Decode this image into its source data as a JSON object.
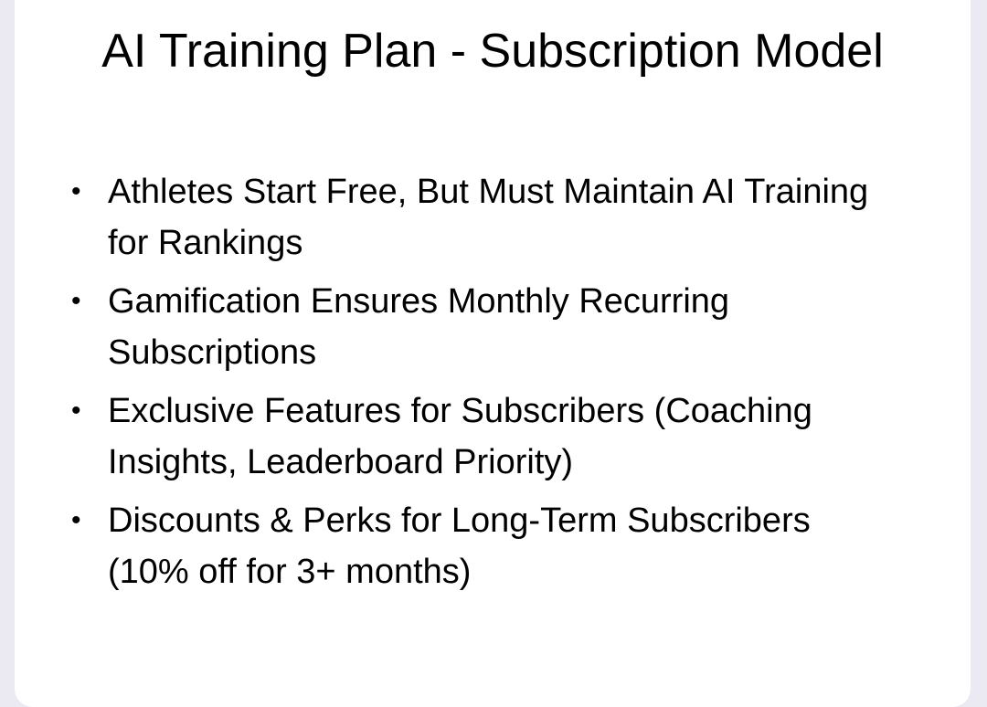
{
  "slide": {
    "title": "AI Training Plan - Subscription Model",
    "bullets": [
      "Athletes Start Free, But Must Maintain AI Training for Rankings",
      "Gamification Ensures Monthly Recurring Subscriptions",
      "Exclusive Features for Subscribers (Coaching Insights, Leaderboard Priority)",
      "Discounts & Perks for Long-Term Subscribers (10% off for 3+ months)"
    ]
  }
}
